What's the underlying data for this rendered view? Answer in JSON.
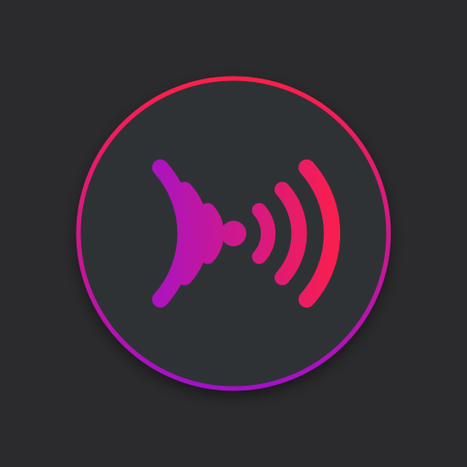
{
  "icon": {
    "name": "broadcast-signal-icon",
    "background_color": "#2b2b2d",
    "disc_color": "#2f3034",
    "ring_gradient_top": "#ff1f4a",
    "ring_gradient_bottom": "#a311c9",
    "wave_gradient_left": "#9b12d6",
    "wave_gradient_right": "#ff1f47",
    "wave_count_per_side": 3
  }
}
